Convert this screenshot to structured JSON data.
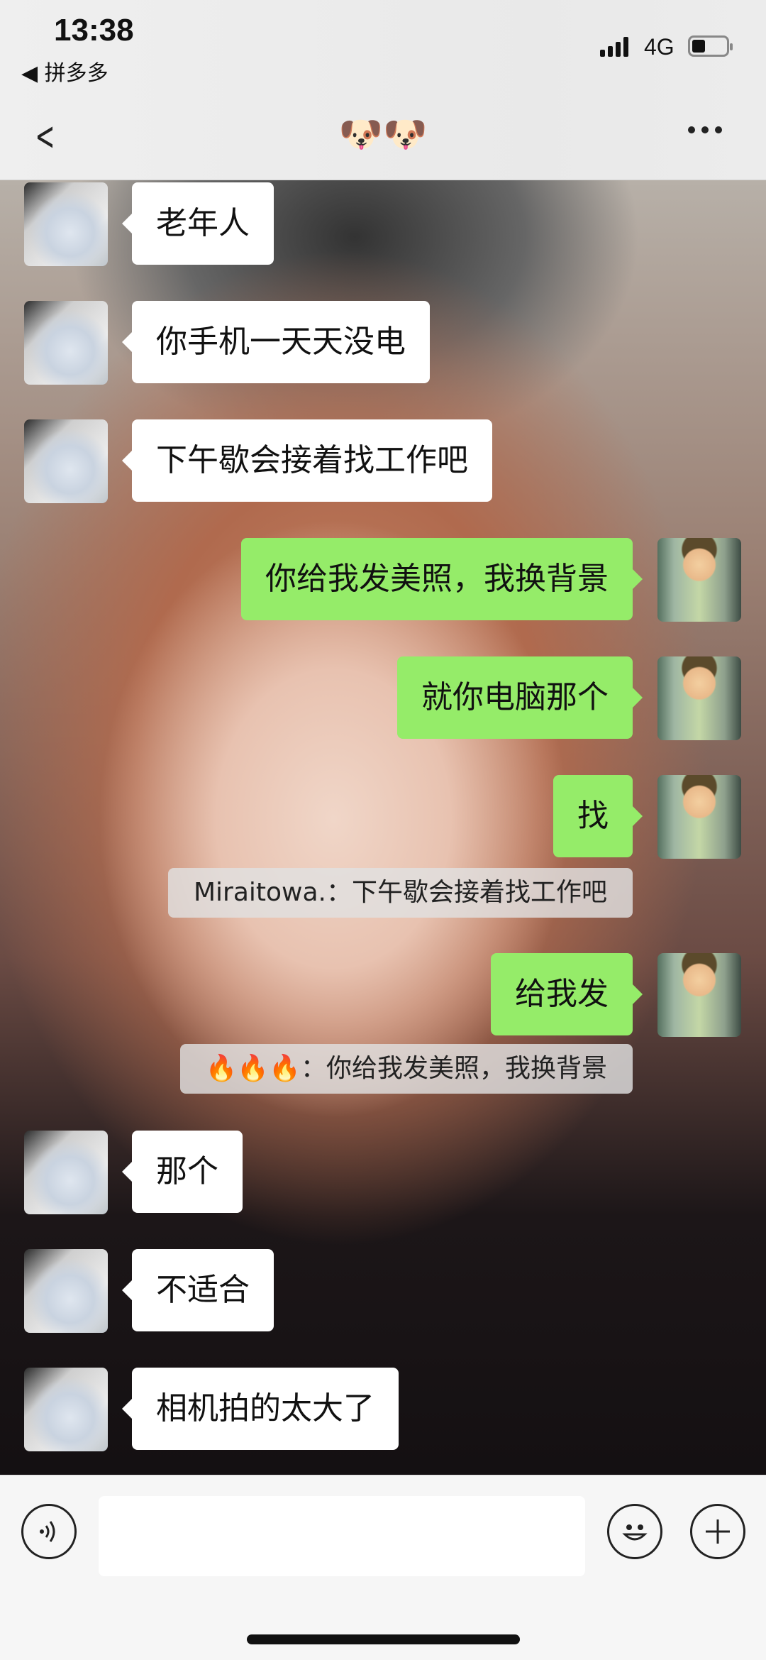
{
  "status_bar": {
    "time": "13:38",
    "back_app": "◀ 拼多多",
    "network": "4G",
    "battery_level_percent": 30
  },
  "nav": {
    "back_icon": "chevron-left-icon",
    "title": "🐶🐶",
    "more_icon": "more-dots-icon"
  },
  "messages": [
    {
      "side": "left",
      "text": "老年人"
    },
    {
      "side": "left",
      "text": "你手机一天天没电"
    },
    {
      "side": "left",
      "text": "下午歇会接着找工作吧"
    },
    {
      "side": "right",
      "text": "你给我发美照，我换背景"
    },
    {
      "side": "right",
      "text": "就你电脑那个"
    },
    {
      "side": "right",
      "text": "找"
    },
    {
      "side": "quote",
      "text": "Miraitowa.：下午歇会接着找工作吧"
    },
    {
      "side": "right",
      "text": "给我发"
    },
    {
      "side": "quote",
      "text": "🔥🔥🔥：你给我发美照，我换背景"
    },
    {
      "side": "left",
      "text": "那个"
    },
    {
      "side": "left",
      "text": "不适合"
    },
    {
      "side": "left",
      "text": "相机拍的太大了"
    }
  ],
  "input_bar": {
    "voice_icon": "voice-icon",
    "input_value": "",
    "emoji_icon": "emoji-icon",
    "plus_icon": "plus-icon"
  },
  "colors": {
    "sent_bubble": "#95ec69",
    "received_bubble": "#ffffff"
  }
}
